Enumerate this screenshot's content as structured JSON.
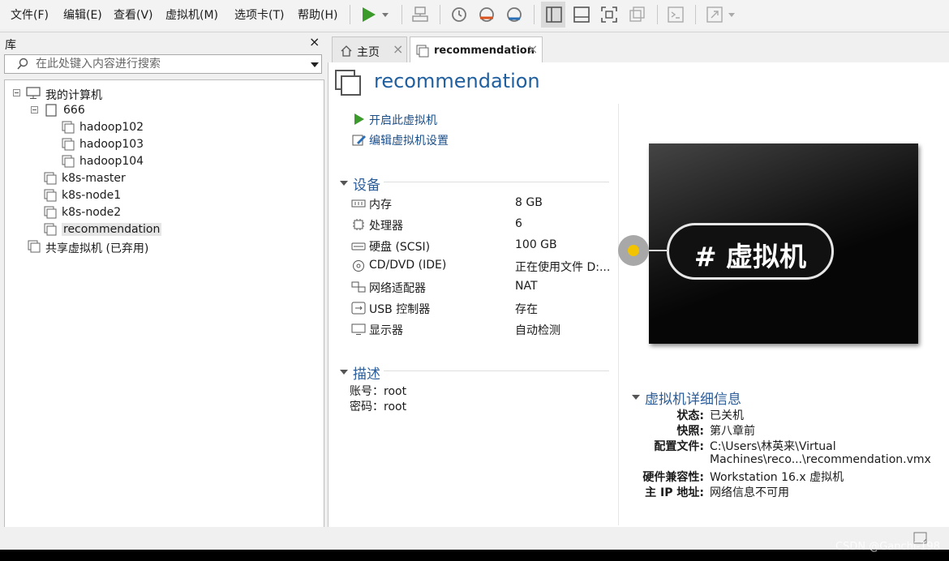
{
  "menu": [
    "文件(F)",
    "编辑(E)",
    "查看(V)",
    "虚拟机(M)",
    "选项卡(T)",
    "帮助(H)"
  ],
  "library": {
    "title": "库",
    "close": "×",
    "search_placeholder": "在此处键入内容进行搜索",
    "tree": {
      "root": "我的计算机",
      "folder": "666",
      "folder_children": [
        "hadoop102",
        "hadoop103",
        "hadoop104"
      ],
      "root_children": [
        "k8s-master",
        "k8s-node1",
        "k8s-node2",
        "recommendation"
      ],
      "shared": "共享虚拟机 (已弃用)"
    }
  },
  "tabs": [
    {
      "label": "主页",
      "close": "×"
    },
    {
      "label": "recommendation",
      "close": "×"
    }
  ],
  "vm": {
    "title": "recommendation",
    "actions": [
      "开启此虚拟机",
      "编辑虚拟机设置"
    ],
    "devices_title": "设备",
    "devices": [
      {
        "icon": "memory-icon",
        "name": "内存",
        "value": "8 GB"
      },
      {
        "icon": "cpu-icon",
        "name": "处理器",
        "value": "6"
      },
      {
        "icon": "hard-disk-icon",
        "name": "硬盘 (SCSI)",
        "value": "100 GB"
      },
      {
        "icon": "cd-dvd-icon",
        "name": "CD/DVD (IDE)",
        "value": "正在使用文件 D:..."
      },
      {
        "icon": "network-adapter-icon",
        "name": "网络适配器",
        "value": "NAT"
      },
      {
        "icon": "usb-icon",
        "name": "USB 控制器",
        "value": "存在"
      },
      {
        "icon": "monitor-icon",
        "name": "显示器",
        "value": "自动检测"
      }
    ],
    "description_title": "描述",
    "description_lines": [
      "账号：root",
      "密码：root"
    ],
    "preview_text": "# 虚拟机",
    "details_title": "虚拟机详细信息",
    "details": [
      {
        "key": "状态:",
        "value": "已关机"
      },
      {
        "key": "快照:",
        "value": "第八章前"
      },
      {
        "key": "配置文件:",
        "value": "C:\\Users\\林英来\\Virtual"
      },
      {
        "key": "",
        "value": "Machines\\reco...\\recommendation.vmx"
      },
      {
        "key": "硬件兼容性:",
        "value": "Workstation 16.x 虚拟机"
      },
      {
        "key": "主 IP 地址:",
        "value": "网络信息不可用"
      }
    ]
  },
  "watermark": "CSDN @Ganchi-198",
  "colors": {
    "accent": "#1f5f9f",
    "link": "#1b4f8a",
    "play_green": "#3a9a2a",
    "dot_yellow": "#f2c300"
  }
}
